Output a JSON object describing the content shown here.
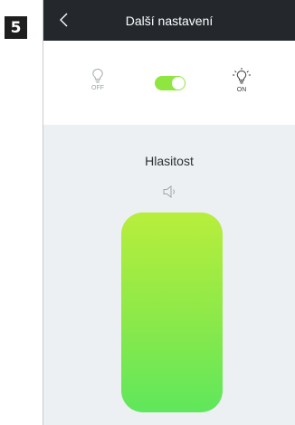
{
  "step_badge": "5",
  "header": {
    "title": "Další nastavení",
    "back_icon": "chevron-left-icon"
  },
  "light_control": {
    "off_label": "OFF",
    "on_label": "ON",
    "toggle_on": true,
    "accent_color": "#8fe640"
  },
  "volume": {
    "label": "Hlasitost",
    "icon": "speaker-icon",
    "level_percent": 100
  },
  "colors": {
    "topbar": "#24282d",
    "background": "#edf0f2"
  }
}
